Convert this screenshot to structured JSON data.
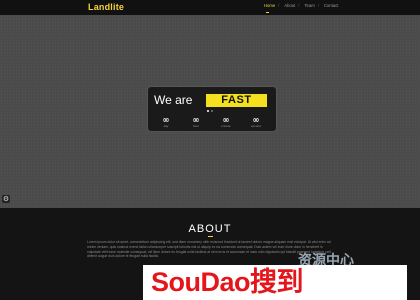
{
  "header": {
    "logo": "Landlite",
    "nav": [
      {
        "label": "Home",
        "active": true
      },
      {
        "label": "About",
        "active": false
      },
      {
        "label": "Team",
        "active": false
      },
      {
        "label": "Contact",
        "active": false
      }
    ],
    "separator": "/"
  },
  "hero": {
    "headline": "We are",
    "highlight": "FAST",
    "countdown": [
      {
        "value": "00",
        "label": "day"
      },
      {
        "value": "00",
        "label": "hour"
      },
      {
        "value": "00",
        "label": "minute"
      },
      {
        "value": "00",
        "label": "second"
      }
    ],
    "settings_icon": "gear-icon"
  },
  "about": {
    "title": "ABOUT",
    "text": "Lorem ipsum dolor sit amet, consectetuer adipiscing elit, sed diam nonummy nibh euismod tincidunt ut laoreet dolore magna aliquam erat volutpat. Ut wisi enim ad minim veniam, quis nostrud exerci tation ullamcorper suscipit lobortis nisl ut aliquip ex ea commodo consequat. Duis autem vel eum iriure dolor in hendrerit in vulputate velit esse molestie consequat, vel illum dolore eu feugiat nulla facilisis at vero eros et accumsan et iusto odio dignissim qui blandit praesent luptatum zzril delenit augue duis dolore te feugait nulla facilisi."
  },
  "banner": {
    "brand": "SouDao搜到",
    "ghost": "资源中心"
  },
  "colors": {
    "accent": "#f2d33a",
    "highlight": "#f4e01e",
    "brand_red": "#e4161c"
  }
}
